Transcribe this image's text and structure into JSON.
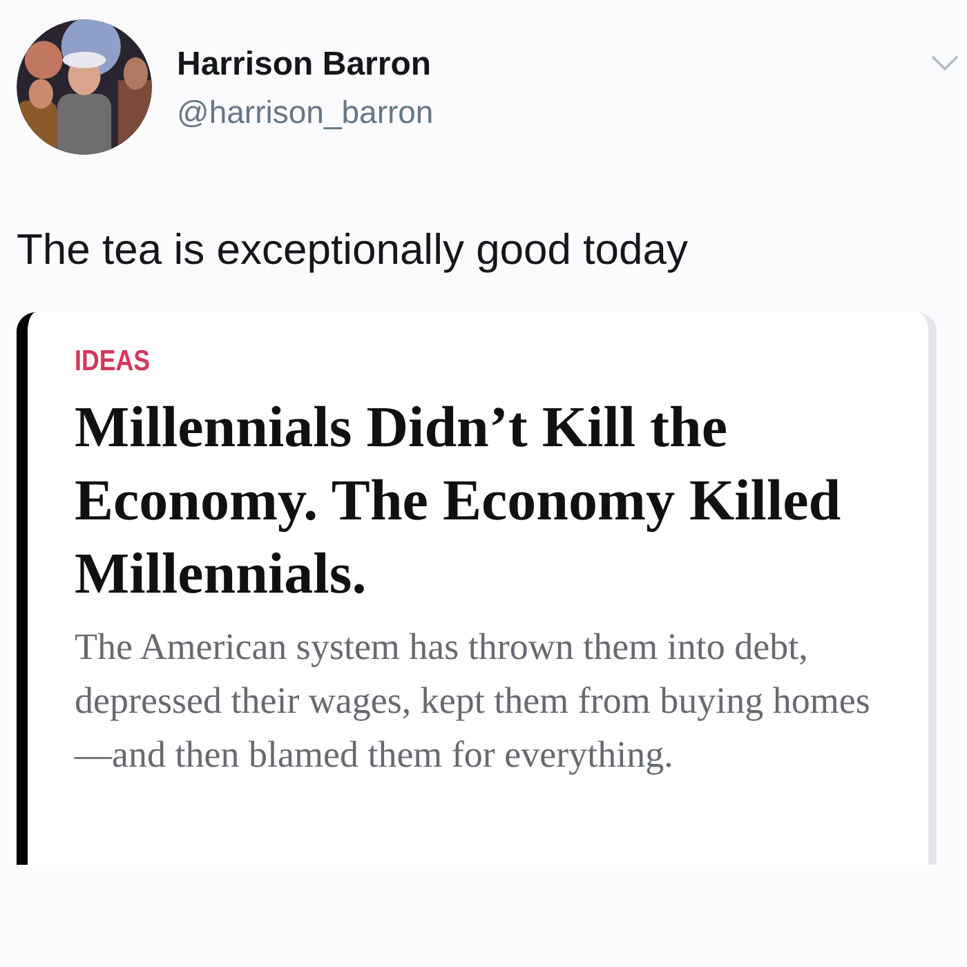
{
  "tweet": {
    "author": {
      "name": "Harrison Barron",
      "handle": "@harrison_barron"
    },
    "text": "The tea is exceptionally good today",
    "embedded_article": {
      "section": "IDEAS",
      "headline": "Millennials Didn’t Kill the Economy. The Economy Killed Millennials.",
      "dek": "The American system has thrown them into debt, depressed their wages, kept them from buying homes—and then blamed them for everything."
    }
  }
}
